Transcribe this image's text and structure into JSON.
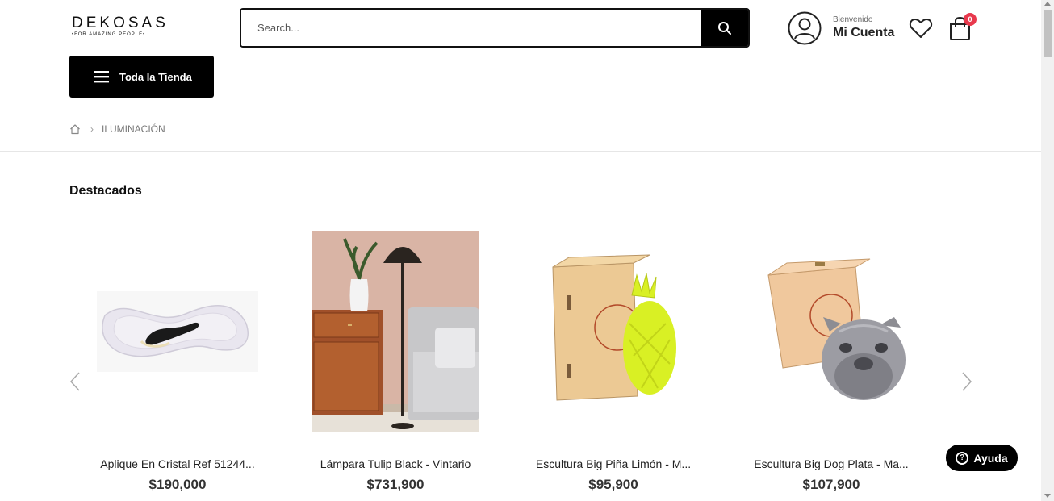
{
  "header": {
    "logo_main": "DEKOSAS",
    "logo_sub": "•FOR AMAZING PEOPLE•",
    "search_placeholder": "Search...",
    "account_greeting": "Bienvenido",
    "account_name": "Mi Cuenta",
    "cart_count": "0"
  },
  "nav": {
    "store_button_label": "Toda la Tienda"
  },
  "breadcrumb": {
    "current": "ILUMINACIÓN"
  },
  "section": {
    "title": "Destacados"
  },
  "products": [
    {
      "name": "Aplique En Cristal Ref 51244...",
      "price": "$190,000"
    },
    {
      "name": "Lámpara Tulip Black - Vintario",
      "price": "$731,900"
    },
    {
      "name": "Escultura Big Piña Limón - M...",
      "price": "$95,900"
    },
    {
      "name": "Escultura Big Dog Plata - Ma...",
      "price": "$107,900"
    }
  ],
  "help": {
    "label": "Ayuda"
  },
  "icons": {
    "search": "search-icon",
    "account": "user-circle-icon",
    "wishlist": "heart-icon",
    "cart": "shopping-bag-icon",
    "menu": "hamburger-icon",
    "home": "home-icon",
    "prev": "chevron-left-icon",
    "next": "chevron-right-icon",
    "help": "question-circle-icon"
  },
  "colors": {
    "brand_black": "#000000",
    "badge": "#e8394d",
    "pineapple": "#d9f024"
  }
}
